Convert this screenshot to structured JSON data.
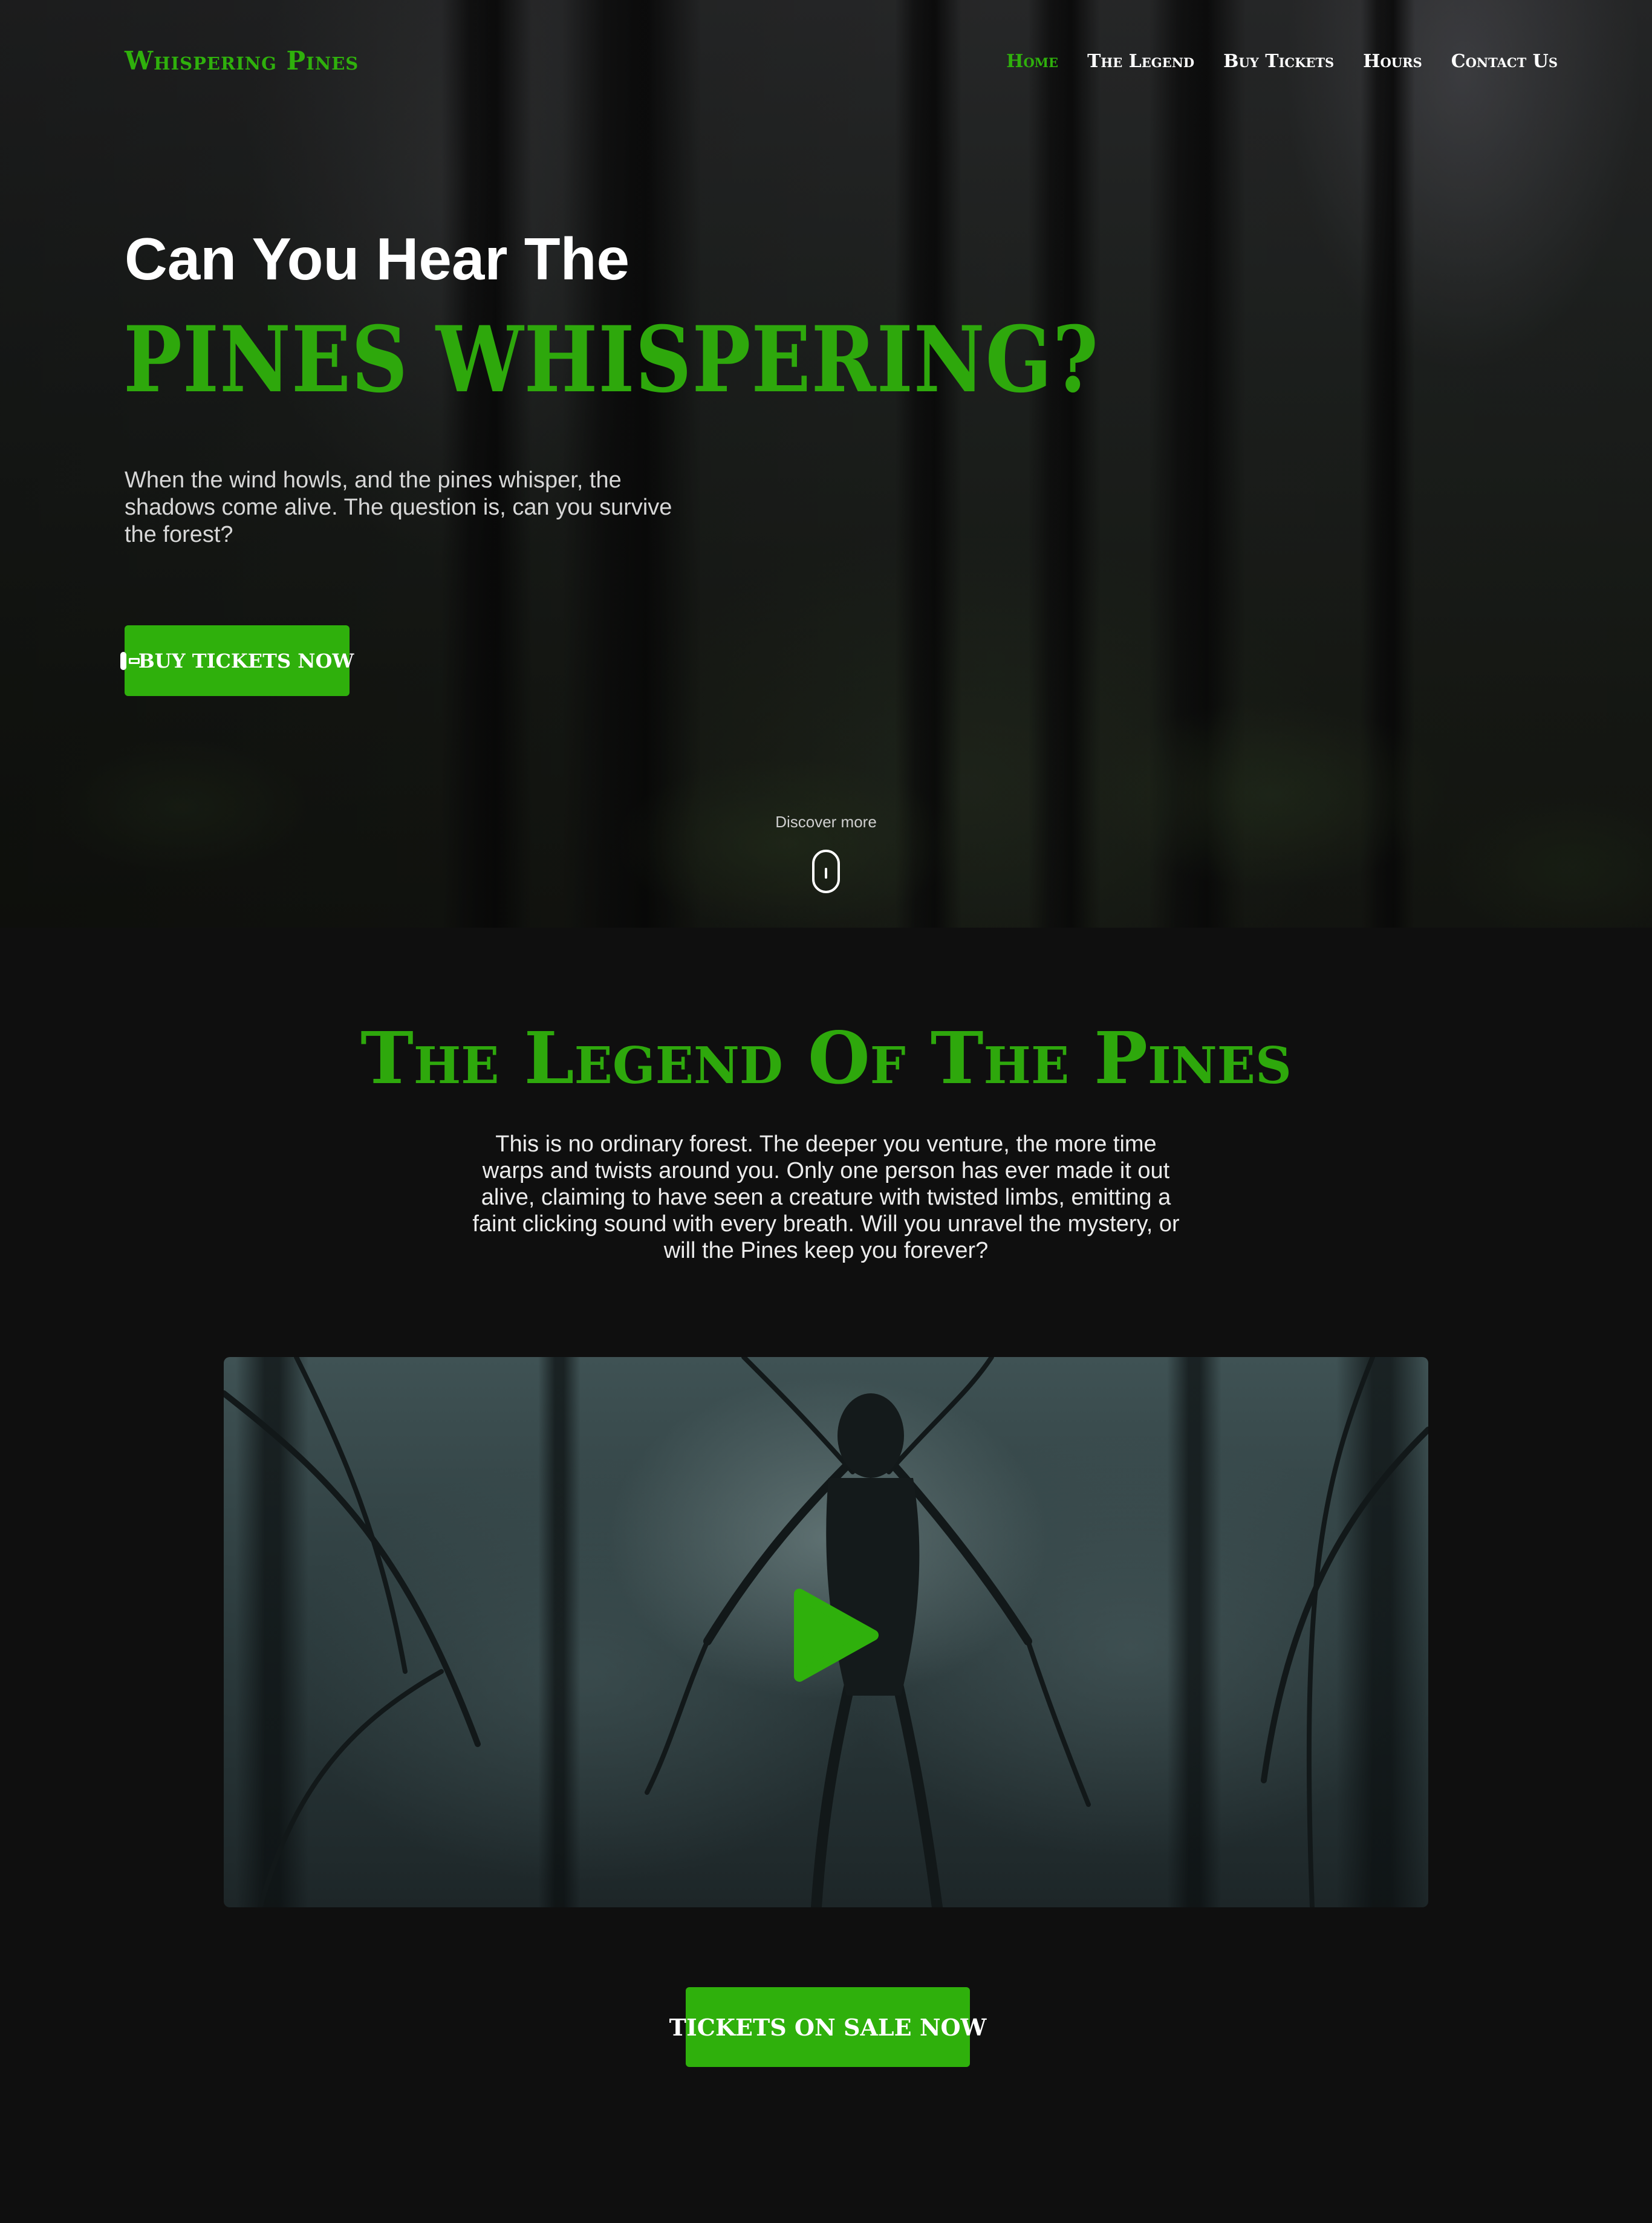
{
  "nav": {
    "brand": "Whispering Pines",
    "links": [
      {
        "label": "Home",
        "active": true
      },
      {
        "label": "The Legend",
        "active": false
      },
      {
        "label": "Buy Tickets",
        "active": false
      },
      {
        "label": "Hours",
        "active": false
      },
      {
        "label": "Contact Us",
        "active": false
      }
    ]
  },
  "hero": {
    "eyebrow": "Can You Hear The",
    "title": "PINES WHISPERING?",
    "text": "When the wind howls, and the pines whisper, the shadows come alive. The question is, can you survive the forest?",
    "button_label": "BUY TICKETS NOW",
    "button_icon": "ticket-icon",
    "discover_label": "Discover more",
    "scroll_icon": "mouse-scroll-icon"
  },
  "legend": {
    "title": "The Legend Of The Pines",
    "text": "This is no ordinary forest. The deeper you venture, the more time warps and twists around you. Only one person has ever made it out alive, claiming to have seen a creature with twisted limbs, emitting a faint clicking sound with every breath. Will you unravel the mystery, or will the Pines keep you forever?",
    "video_icon": "play-icon"
  },
  "cta": {
    "label": "TICKETS ON SALE NOW"
  },
  "colors": {
    "accent": "#2fb00c",
    "background": "#0f0f0f",
    "text": "#ffffff"
  }
}
